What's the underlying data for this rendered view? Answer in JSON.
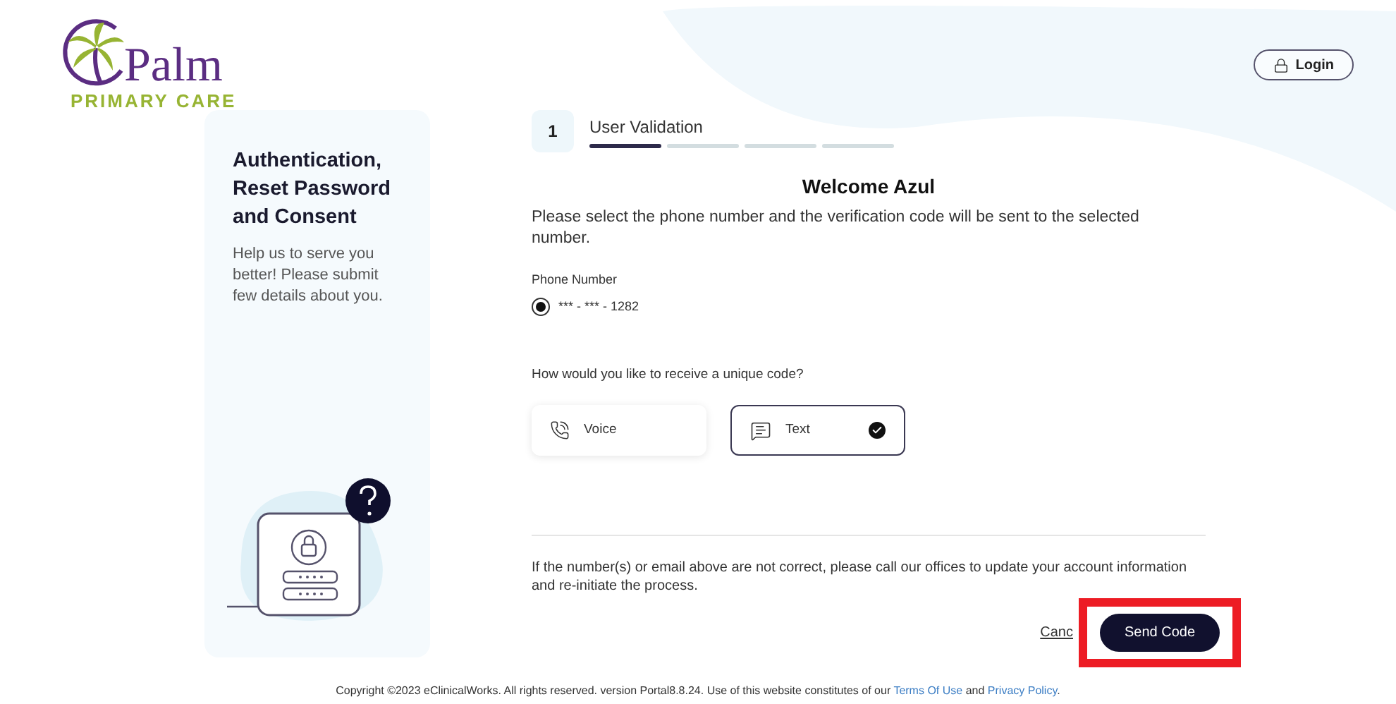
{
  "logo": {
    "name": "Palm",
    "tagline": "PRIMARY CARE"
  },
  "login_button": {
    "label": "Login"
  },
  "sidebar": {
    "title": "Authentication, Reset Password and Consent",
    "text": "Help us to serve you better! Please submit few details about you."
  },
  "stepper": {
    "number": "1",
    "label": "User Validation",
    "segments": [
      {
        "active": true
      },
      {
        "active": false
      },
      {
        "active": false
      },
      {
        "active": false
      }
    ]
  },
  "heading": "Welcome Azul",
  "intro": "Please select the phone number and the verification code will be sent to the selected number.",
  "phone": {
    "label": "Phone Number",
    "options": [
      {
        "value": "*** - *** - 1282",
        "selected": true
      }
    ]
  },
  "method": {
    "question": "How would you like to receive a unique code?",
    "options": [
      {
        "kind": "voice",
        "label": "Voice",
        "selected": false
      },
      {
        "kind": "text",
        "label": "Text",
        "selected": true
      }
    ]
  },
  "note": "If the number(s) or email above are not correct, please call our offices to update your account information and re-initiate the process.",
  "actions": {
    "cancel": "Canc",
    "submit": "Send Code",
    "highlighted": true
  },
  "footer": {
    "text": "Copyright ©2023 eClinicalWorks. All rights reserved. version  Portal8.8.24.  Use of this website constitutes of our",
    "terms": "Terms Of Use",
    "and": "and",
    "privacy": "Privacy Policy",
    "end": "."
  }
}
